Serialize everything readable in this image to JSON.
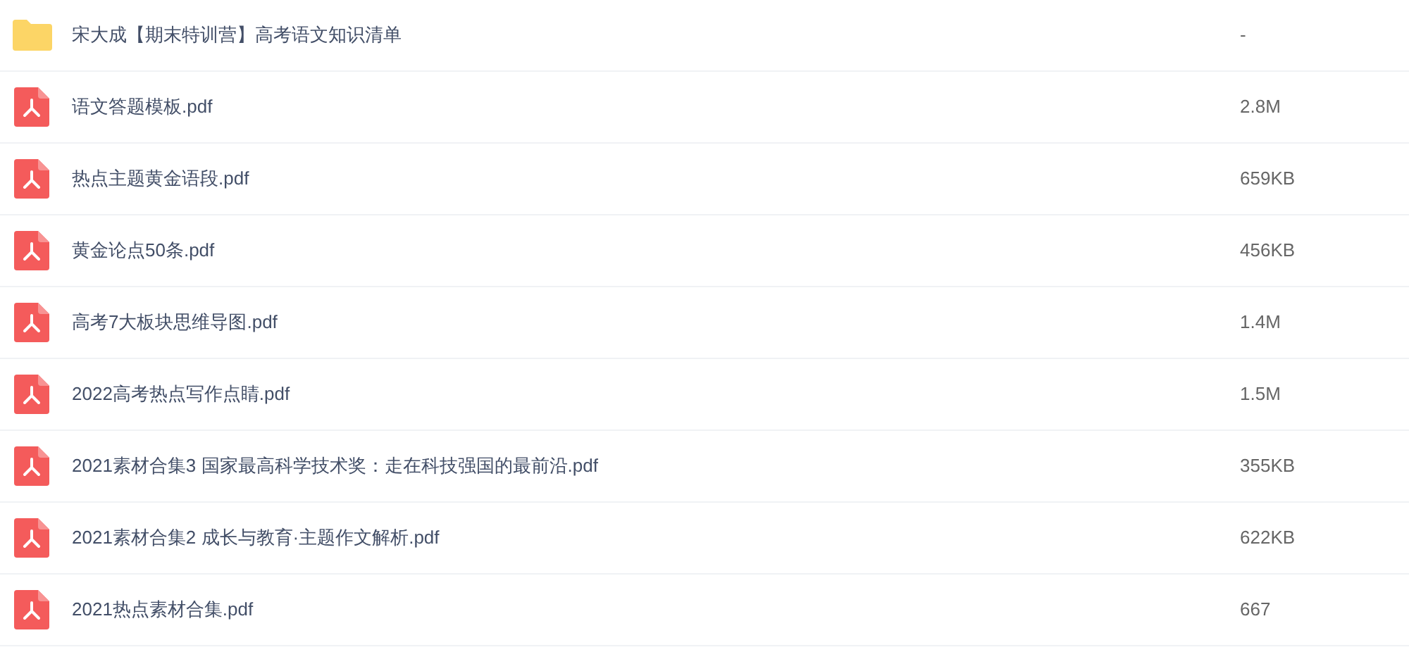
{
  "files": [
    {
      "kind": "folder",
      "name": "宋大成【期末特训营】高考语文知识清单",
      "size": "-"
    },
    {
      "kind": "pdf",
      "name": "语文答题模板.pdf",
      "size": "2.8M"
    },
    {
      "kind": "pdf",
      "name": "热点主题黄金语段.pdf",
      "size": "659KB"
    },
    {
      "kind": "pdf",
      "name": "黄金论点50条.pdf",
      "size": "456KB"
    },
    {
      "kind": "pdf",
      "name": "高考7大板块思维导图.pdf",
      "size": "1.4M"
    },
    {
      "kind": "pdf",
      "name": "2022高考热点写作点睛.pdf",
      "size": "1.5M"
    },
    {
      "kind": "pdf",
      "name": "2021素材合集3 国家最高科学技术奖：走在科技强国的最前沿.pdf",
      "size": "355KB"
    },
    {
      "kind": "pdf",
      "name": "2021素材合集2 成长与教育·主题作文解析.pdf",
      "size": "622KB"
    },
    {
      "kind": "pdf",
      "name": "2021热点素材合集.pdf",
      "size": "667"
    }
  ]
}
